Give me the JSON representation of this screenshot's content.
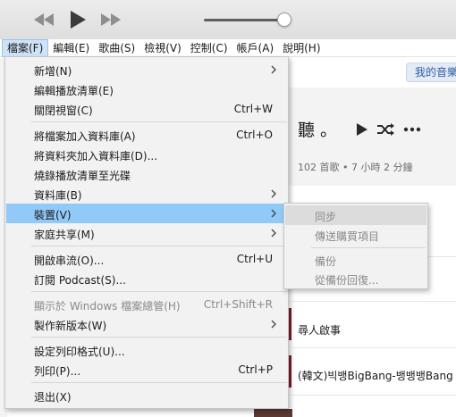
{
  "menubar": {
    "items": [
      "檔案(F)",
      "編輯(E)",
      "歌曲(S)",
      "檢視(V)",
      "控制(C)",
      "帳戶(A)",
      "說明(H)"
    ]
  },
  "content": {
    "library_pill": "我的音樂",
    "playlist_title": "聽 。",
    "playlist_meta": "102 首歌 • 7 小時 2 分鐘",
    "rows": [
      "尋人啟事",
      "(韓文)빅뱅BigBang-뱅뱅뱅Bang B"
    ]
  },
  "file_menu": {
    "items": [
      {
        "label": "新增(N)",
        "shortcut": "",
        "arrow": true,
        "disabled": false
      },
      {
        "label": "編輯播放清單(E)",
        "shortcut": "",
        "arrow": false,
        "disabled": false
      },
      {
        "label": "關閉視窗(C)",
        "shortcut": "Ctrl+W",
        "arrow": false,
        "disabled": false
      },
      {
        "label": "將檔案加入資料庫(A)",
        "shortcut": "Ctrl+O",
        "arrow": false,
        "disabled": false
      },
      {
        "label": "將資料夾加入資料庫(D)...",
        "shortcut": "",
        "arrow": false,
        "disabled": false
      },
      {
        "label": "燒錄播放清單至光碟",
        "shortcut": "",
        "arrow": false,
        "disabled": false
      },
      {
        "label": "資料庫(B)",
        "shortcut": "",
        "arrow": true,
        "disabled": false
      },
      {
        "label": "裝置(V)",
        "shortcut": "",
        "arrow": true,
        "disabled": false
      },
      {
        "label": "家庭共享(M)",
        "shortcut": "",
        "arrow": true,
        "disabled": false
      },
      {
        "label": "開啟串流(O)...",
        "shortcut": "Ctrl+U",
        "arrow": false,
        "disabled": false
      },
      {
        "label": "訂閱 Podcast(S)...",
        "shortcut": "",
        "arrow": false,
        "disabled": false
      },
      {
        "label": "顯示於 Windows 檔案總管(H)",
        "shortcut": "Ctrl+Shift+R",
        "arrow": false,
        "disabled": true
      },
      {
        "label": "製作新版本(W)",
        "shortcut": "",
        "arrow": true,
        "disabled": false
      },
      {
        "label": "設定列印格式(U)...",
        "shortcut": "",
        "arrow": false,
        "disabled": false
      },
      {
        "label": "列印(P)...",
        "shortcut": "Ctrl+P",
        "arrow": false,
        "disabled": false
      },
      {
        "label": "退出(X)",
        "shortcut": "",
        "arrow": false,
        "disabled": false
      }
    ]
  },
  "device_submenu": {
    "items": [
      "同步",
      "傳送購買項目",
      "備份",
      "從備份回復..."
    ]
  }
}
